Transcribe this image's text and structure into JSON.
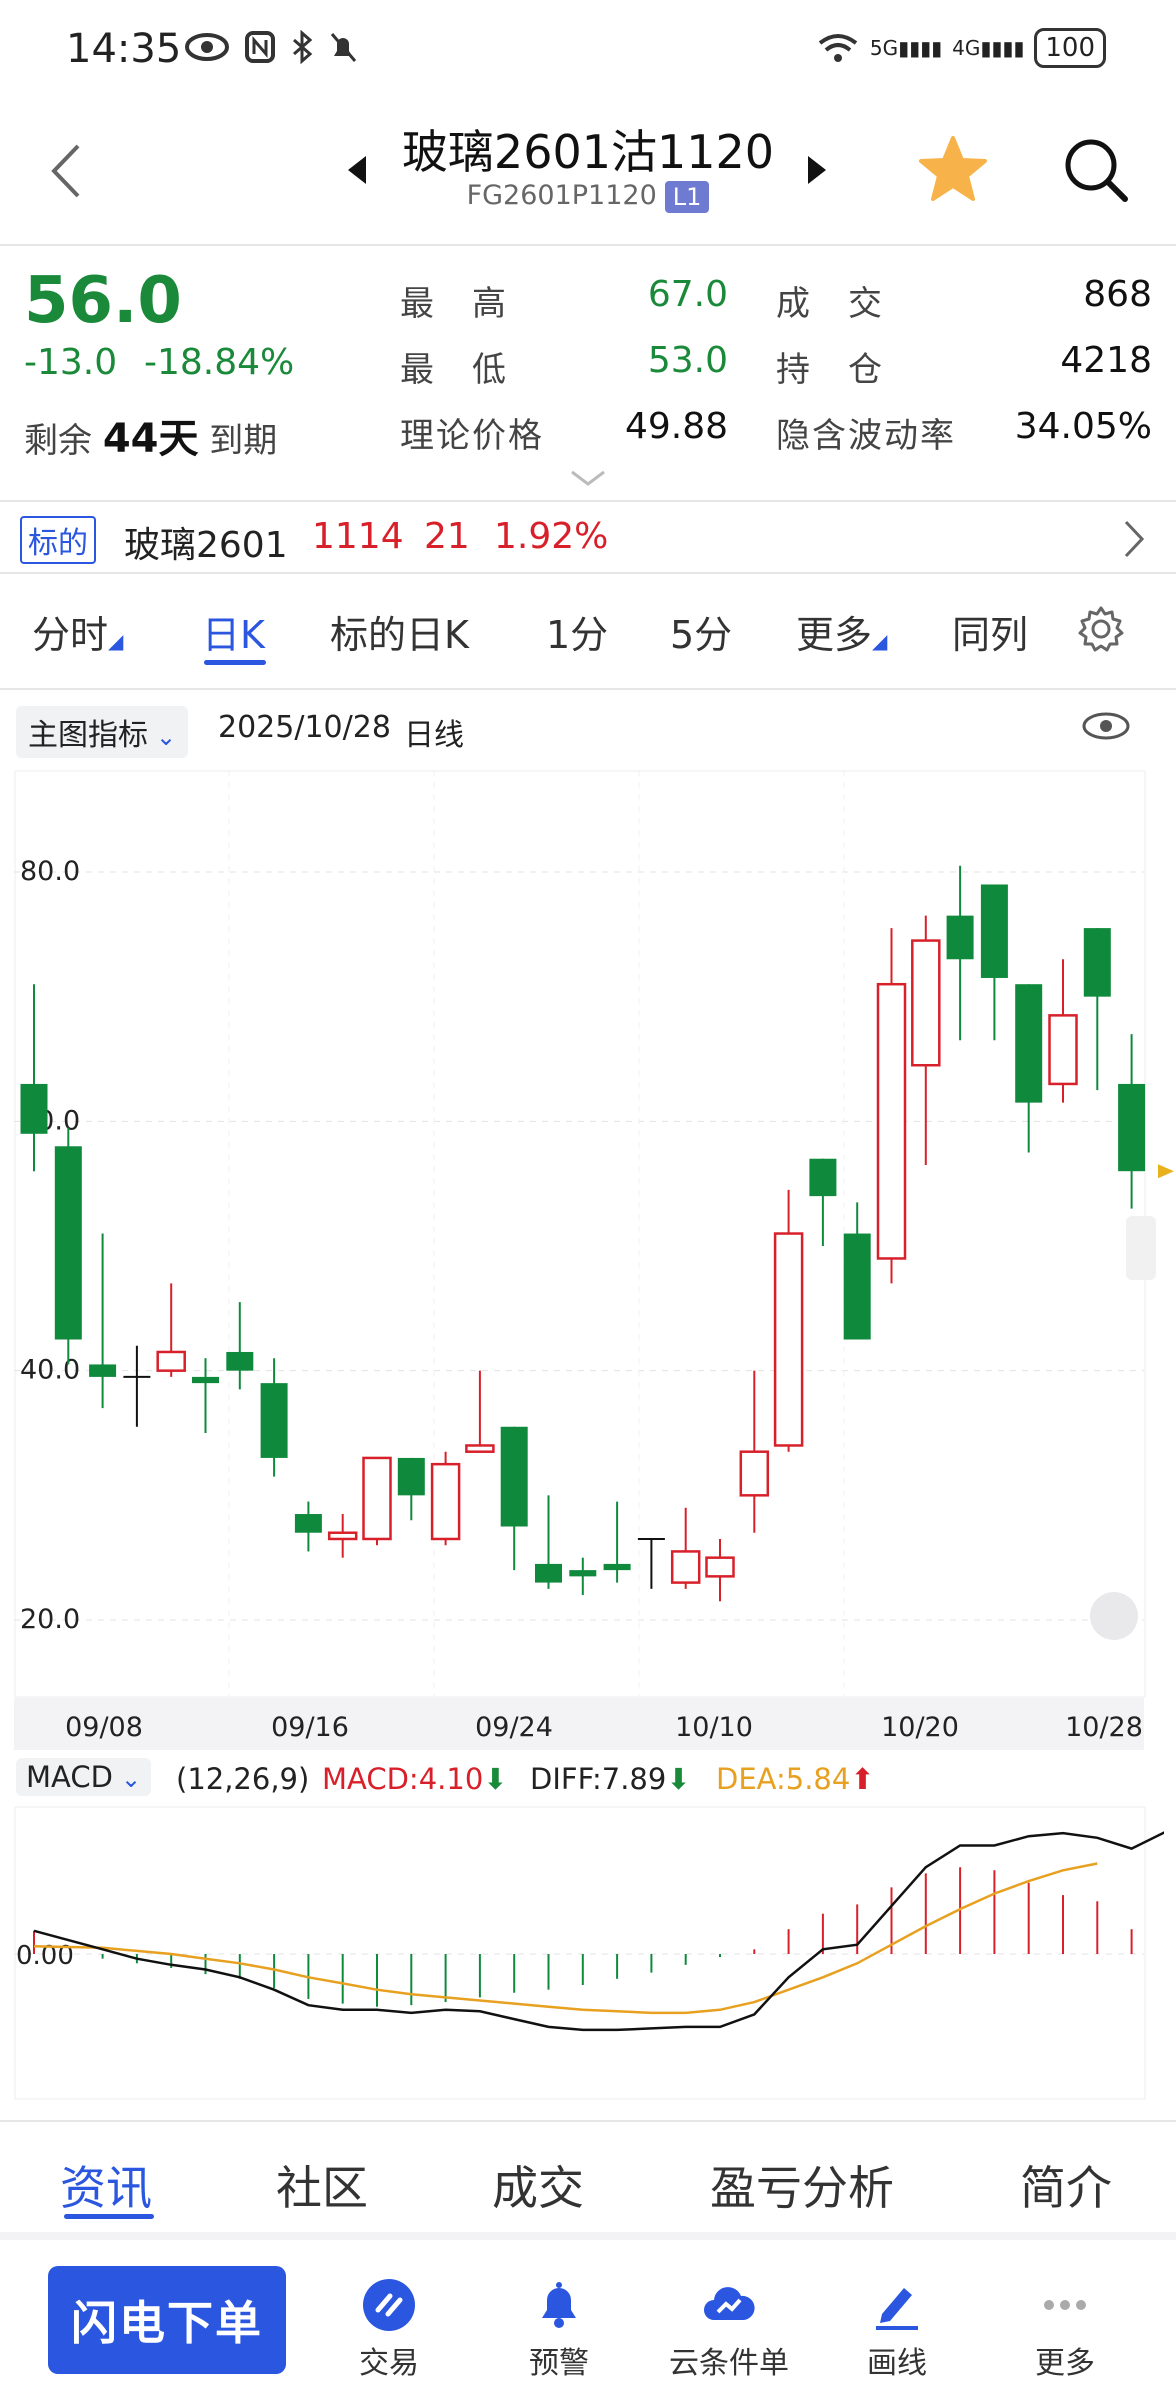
{
  "status": {
    "time": "14:35",
    "icons": [
      "eye-icon",
      "nfc-icon",
      "bluetooth-icon",
      "bell-off-icon"
    ],
    "network": "5G 4G",
    "battery": "100"
  },
  "header": {
    "title": "玻璃2601沽1120",
    "code": "FG2601P1120",
    "level": "L1"
  },
  "quote": {
    "price": "56.0",
    "change": "-13.0",
    "change_pct": "-18.84%",
    "expiry_prefix": "剩余",
    "expiry_days": "44天",
    "expiry_suffix": "到期",
    "high_label": "最　高",
    "high": "67.0",
    "low_label": "最　低",
    "low": "53.0",
    "theo_label": "理论价格",
    "theo": "49.88",
    "vol_label": "成　交",
    "vol": "868",
    "oi_label": "持　仓",
    "oi": "4218",
    "iv_label": "隐含波动率",
    "iv": "34.05%"
  },
  "underlying": {
    "tag": "标的",
    "name": "玻璃2601",
    "price": "1114",
    "change": "21",
    "pct": "1.92%"
  },
  "tabs": [
    "分时",
    "日K",
    "标的日K",
    "1分",
    "5分",
    "更多",
    "同列"
  ],
  "active_tab": "日K",
  "indicator": {
    "label": "主图指标",
    "date": "2025/10/28",
    "period": "日线"
  },
  "macd": {
    "label": "MACD",
    "params": "(12,26,9)",
    "macd": "MACD:4.10",
    "diff": "DIFF:7.89",
    "dea": "DEA:5.84"
  },
  "colors": {
    "up": "#d8202a",
    "down": "#0f8a3c",
    "accent": "#2a56e0",
    "dea_line": "#e8a020"
  },
  "chart_data": {
    "type": "candlestick",
    "y_ticks": [
      "80.0",
      "60.0",
      "40.0",
      "20.0"
    ],
    "ylim": [
      20,
      80
    ],
    "x_ticks": [
      "09/08",
      "09/16",
      "09/24",
      "10/10",
      "10/20",
      "10/28"
    ],
    "candles": [
      {
        "o": 63.0,
        "c": 59.0,
        "h": 71.0,
        "l": 56.0
      },
      {
        "o": 58.0,
        "c": 42.5,
        "h": 59.5,
        "l": 40.5
      },
      {
        "o": 40.5,
        "c": 39.5,
        "h": 51.0,
        "l": 37.0
      },
      {
        "o": 39.5,
        "c": 39.5,
        "h": 42.0,
        "l": 35.5
      },
      {
        "o": 40.0,
        "c": 41.5,
        "h": 47.0,
        "l": 39.5
      },
      {
        "o": 39.5,
        "c": 39.0,
        "h": 41.0,
        "l": 35.0
      },
      {
        "o": 41.5,
        "c": 40.0,
        "h": 45.5,
        "l": 38.5
      },
      {
        "o": 39.0,
        "c": 33.0,
        "h": 41.0,
        "l": 31.5
      },
      {
        "o": 28.5,
        "c": 27.0,
        "h": 29.5,
        "l": 25.5
      },
      {
        "o": 26.5,
        "c": 27.0,
        "h": 28.5,
        "l": 25.0
      },
      {
        "o": 26.5,
        "c": 33.0,
        "h": 33.0,
        "l": 26.0
      },
      {
        "o": 33.0,
        "c": 30.0,
        "h": 33.0,
        "l": 28.0
      },
      {
        "o": 26.5,
        "c": 32.5,
        "h": 33.5,
        "l": 26.0
      },
      {
        "o": 33.5,
        "c": 34.0,
        "h": 40.0,
        "l": 33.5
      },
      {
        "o": 35.5,
        "c": 27.5,
        "h": 35.5,
        "l": 24.0
      },
      {
        "o": 24.5,
        "c": 23.0,
        "h": 30.0,
        "l": 22.5
      },
      {
        "o": 24.0,
        "c": 23.5,
        "h": 25.0,
        "l": 22.0
      },
      {
        "o": 24.5,
        "c": 24.0,
        "h": 29.5,
        "l": 23.0
      },
      {
        "o": 26.5,
        "c": 26.5,
        "h": 26.5,
        "l": 22.5
      },
      {
        "o": 23.0,
        "c": 25.5,
        "h": 29.0,
        "l": 22.5
      },
      {
        "o": 23.5,
        "c": 25.0,
        "h": 26.5,
        "l": 21.5
      },
      {
        "o": 30.0,
        "c": 33.5,
        "h": 40.0,
        "l": 27.0
      },
      {
        "o": 34.0,
        "c": 51.0,
        "h": 54.5,
        "l": 33.5
      },
      {
        "o": 57.0,
        "c": 54.0,
        "h": 57.0,
        "l": 50.0
      },
      {
        "o": 51.0,
        "c": 42.5,
        "h": 53.5,
        "l": 42.5
      },
      {
        "o": 49.0,
        "c": 71.0,
        "h": 75.5,
        "l": 47.0
      },
      {
        "o": 64.5,
        "c": 74.5,
        "h": 76.5,
        "l": 56.5
      },
      {
        "o": 76.5,
        "c": 73.0,
        "h": 80.5,
        "l": 66.5
      },
      {
        "o": 79.0,
        "c": 71.5,
        "h": 79.0,
        "l": 66.5
      },
      {
        "o": 71.0,
        "c": 61.5,
        "h": 71.0,
        "l": 57.5
      },
      {
        "o": 63.0,
        "c": 68.5,
        "h": 73.0,
        "l": 61.5
      },
      {
        "o": 75.5,
        "c": 70.0,
        "h": 75.5,
        "l": 62.5
      },
      {
        "o": 63.0,
        "c": 56.0,
        "h": 67.0,
        "l": 53.0
      }
    ],
    "macd_hist": [
      1.5,
      0,
      -0.3,
      -0.6,
      -0.9,
      -1.3,
      -1.6,
      -2.2,
      -2.9,
      -3.2,
      -3.4,
      -3.3,
      -3.1,
      -2.8,
      -2.5,
      -2.3,
      -2.0,
      -1.6,
      -1.2,
      -0.7,
      -0.2,
      0.3,
      1.6,
      2.6,
      3.2,
      4.3,
      5.2,
      5.6,
      5.4,
      4.6,
      3.8,
      3.4,
      1.6,
      2.0
    ],
    "diff": [
      1.5,
      0.9,
      0.3,
      -0.3,
      -0.7,
      -1.0,
      -1.5,
      -2.3,
      -3.3,
      -3.6,
      -3.6,
      -3.8,
      -3.6,
      -3.7,
      -4.2,
      -4.7,
      -4.9,
      -4.9,
      -4.8,
      -4.7,
      -4.7,
      -3.9,
      -1.5,
      0.3,
      0.6,
      3.1,
      5.6,
      7.0,
      7.0,
      7.6,
      7.8,
      7.5,
      6.8,
      7.89
    ],
    "dea": [
      0.5,
      0.45,
      0.4,
      0.2,
      0,
      -0.3,
      -0.6,
      -1.0,
      -1.5,
      -1.9,
      -2.3,
      -2.6,
      -2.8,
      -3.0,
      -3.2,
      -3.4,
      -3.6,
      -3.7,
      -3.8,
      -3.8,
      -3.6,
      -3.1,
      -2.3,
      -1.5,
      -0.6,
      0.6,
      1.8,
      2.9,
      3.9,
      4.7,
      5.4,
      5.84
    ]
  },
  "bottom_tabs": [
    "资讯",
    "社区",
    "成交",
    "盈亏分析",
    "简介"
  ],
  "bottom_active": "资讯",
  "nav": {
    "flash": "闪电下单",
    "items": [
      "交易",
      "预警",
      "云条件单",
      "画线",
      "更多"
    ]
  }
}
